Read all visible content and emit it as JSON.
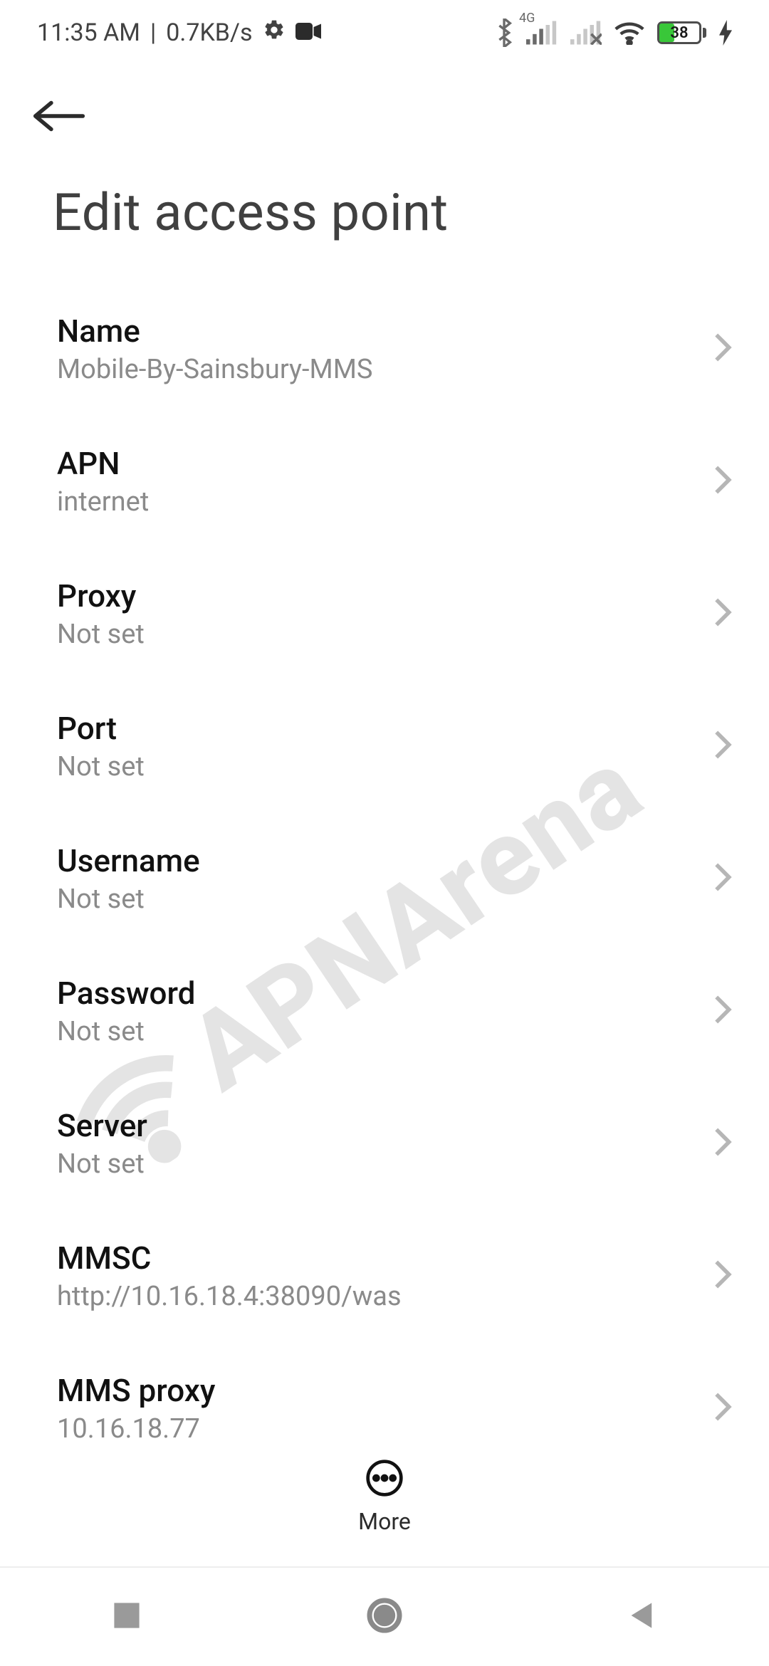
{
  "status": {
    "time": "11:35 AM",
    "data_rate": "0.7KB/s",
    "network_badge": "4G",
    "battery_pct": 38
  },
  "page": {
    "title": "Edit access point"
  },
  "settings": [
    {
      "label": "Name",
      "value": "Mobile-By-Sainsbury-MMS"
    },
    {
      "label": "APN",
      "value": "internet"
    },
    {
      "label": "Proxy",
      "value": "Not set"
    },
    {
      "label": "Port",
      "value": "Not set"
    },
    {
      "label": "Username",
      "value": "Not set"
    },
    {
      "label": "Password",
      "value": "Not set"
    },
    {
      "label": "Server",
      "value": "Not set"
    },
    {
      "label": "MMSC",
      "value": "http://10.16.18.4:38090/was"
    },
    {
      "label": "MMS proxy",
      "value": "10.16.18.77"
    }
  ],
  "more_label": "More",
  "watermark_text": "APNArena"
}
